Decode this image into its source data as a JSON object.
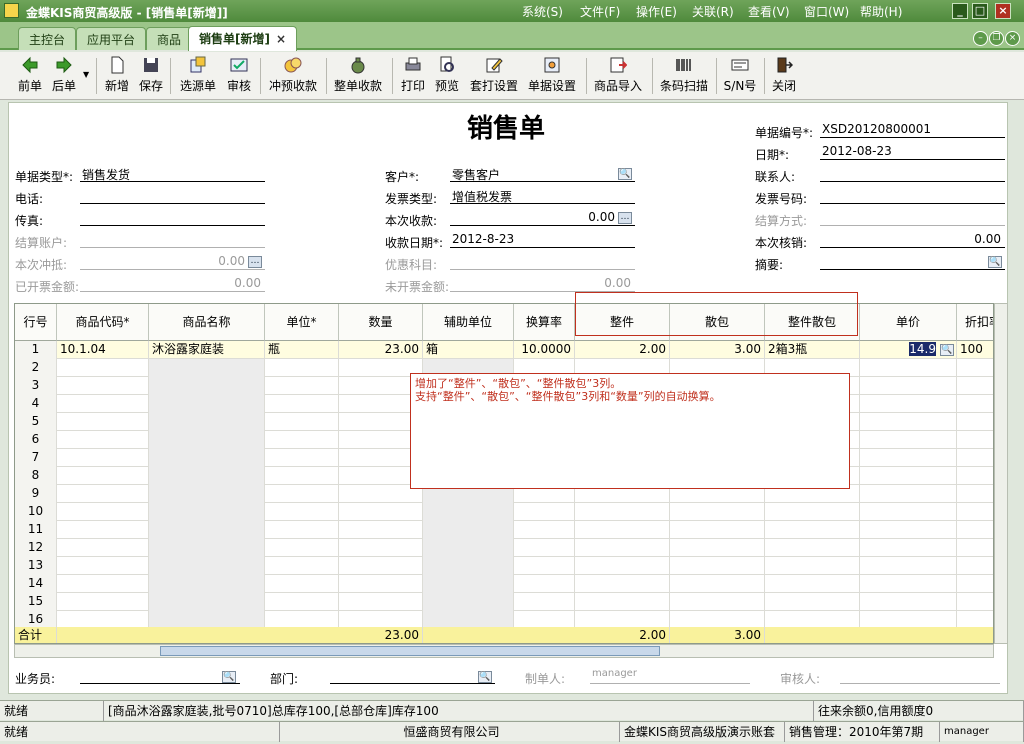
{
  "app": {
    "title": "金蝶KIS商贸高级版 - [销售单[新增]]"
  },
  "menu": [
    "系统(S)",
    "文件(F)",
    "操作(E)",
    "关联(R)",
    "查看(V)",
    "窗口(W)",
    "帮助(H)"
  ],
  "tabs": [
    "主控台",
    "应用平台",
    "商品",
    "销售单[新增]"
  ],
  "toolbar": [
    "前单",
    "后单",
    "新增",
    "保存",
    "选源单",
    "审核",
    "冲预收款",
    "整单收款",
    "打印",
    "预览",
    "套打设置",
    "单据设置",
    "商品导入",
    "条码扫描",
    "S/N号",
    "关闭"
  ],
  "doc_title": "销售单",
  "form": {
    "bill_no_label": "单据编号*:",
    "bill_no": "XSD20120800001",
    "date_label": "日期*:",
    "date": "2012-08-23",
    "type_label": "单据类型*:",
    "type": "销售发货",
    "customer_label": "客户*:",
    "customer": "零售客户",
    "contact_label": "联系人:",
    "contact": "",
    "phone_label": "电话:",
    "phone": "",
    "invoice_type_label": "发票类型:",
    "invoice_type": "增值税发票",
    "invoice_no_label": "发票号码:",
    "invoice_no": "",
    "fax_label": "传真:",
    "fax": "",
    "receipt_label": "本次收款:",
    "receipt": "0.00",
    "settle_method_label": "结算方式:",
    "settle_method": "",
    "account_label": "结算账户:",
    "account": "",
    "receipt_date_label": "收款日期*:",
    "receipt_date": "2012-8-23",
    "verify_label": "本次核销:",
    "verify": "0.00",
    "offset_label": "本次冲抵:",
    "offset": "0.00",
    "discount_subject_label": "优惠科目:",
    "discount_subject": "",
    "summary_label": "摘要:",
    "summary": "",
    "invoiced_label": "已开票金额:",
    "invoiced": "0.00",
    "uninvoiced_label": "未开票金额:",
    "uninvoiced": "0.00"
  },
  "grid": {
    "headers": [
      "行号",
      "商品代码*",
      "商品名称",
      "单位*",
      "数量",
      "辅助单位",
      "换算率",
      "整件",
      "散包",
      "整件散包",
      "单价",
      "折扣率"
    ],
    "row1": {
      "no": "1",
      "code": "10.1.04",
      "name": "沐浴露家庭装",
      "unit": "瓶",
      "qty": "23.00",
      "aux": "箱",
      "rate": "10.0000",
      "whole": "2.00",
      "loose": "3.00",
      "mixed": "2箱3瓶",
      "price": "14.9",
      "disc": "100"
    },
    "rownums": [
      "2",
      "3",
      "4",
      "5",
      "6",
      "7",
      "8",
      "9",
      "10",
      "11",
      "12",
      "13",
      "14",
      "15",
      "16"
    ],
    "sum": {
      "label": "合计",
      "qty": "23.00",
      "whole": "2.00",
      "loose": "3.00"
    }
  },
  "note": {
    "line1": "增加了“整件”、“散包”、“整件散包”3列。",
    "line2": "支持“整件”、“散包”、“整件散包”3列和“数量”列的自动换算。"
  },
  "footer": {
    "salesman_label": "业务员:",
    "salesman": "",
    "dept_label": "部门:",
    "dept": "",
    "maker_label": "制单人:",
    "maker": "manager",
    "auditor_label": "审核人:",
    "auditor": ""
  },
  "status1": {
    "a": "就绪",
    "b": "[商品沐浴露家庭装,批号0710]总库存100,[总部仓库]库存100",
    "c": "往来余额0,信用额度0"
  },
  "status2": {
    "a": "就绪",
    "b": "恒盛商贸有限公司",
    "c": "金蝶KIS商贸高级版演示账套",
    "d": "销售管理：2010年第7期",
    "e": "manager"
  }
}
